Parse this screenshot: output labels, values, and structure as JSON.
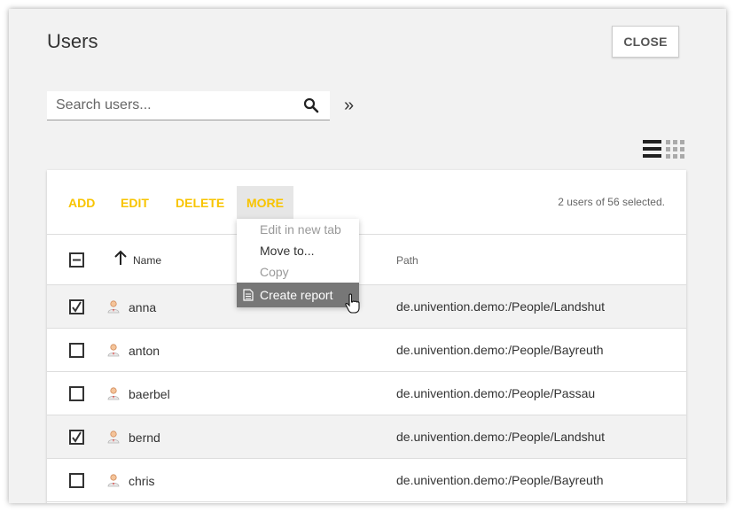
{
  "window": {
    "title": "Users",
    "close_label": "CLOSE"
  },
  "search": {
    "placeholder": "Search users...",
    "value": "",
    "expand_label": "»"
  },
  "toolbar": {
    "buttons": [
      "ADD",
      "EDIT",
      "DELETE",
      "MORE"
    ],
    "selected_text": "2 users of 56 selected.",
    "accent_color": "#f8c400"
  },
  "more_menu": {
    "items": [
      {
        "label": "Edit in new tab",
        "state": "disabled"
      },
      {
        "label": "Move to...",
        "state": "enabled"
      },
      {
        "label": "Copy",
        "state": "disabled"
      },
      {
        "label": "Create report",
        "state": "highlighted",
        "icon": "report-icon"
      }
    ]
  },
  "table": {
    "columns": [
      "Name",
      "Path"
    ],
    "sort": "ascending",
    "rows": [
      {
        "name": "anna",
        "path": "de.univention.demo:/People/Landshut",
        "checked": true
      },
      {
        "name": "anton",
        "path": "de.univention.demo:/People/Bayreuth",
        "checked": false
      },
      {
        "name": "baerbel",
        "path": "de.univention.demo:/People/Passau",
        "checked": false
      },
      {
        "name": "bernd",
        "path": "de.univention.demo:/People/Landshut",
        "checked": true
      },
      {
        "name": "chris",
        "path": "de.univention.demo:/People/Bayreuth",
        "checked": false
      }
    ]
  },
  "icons": [
    "search-icon",
    "double-chevron-right-icon",
    "list-view-icon",
    "grid-view-icon",
    "sort-arrow-up-icon",
    "user-icon",
    "report-icon",
    "hand-cursor-icon"
  ]
}
